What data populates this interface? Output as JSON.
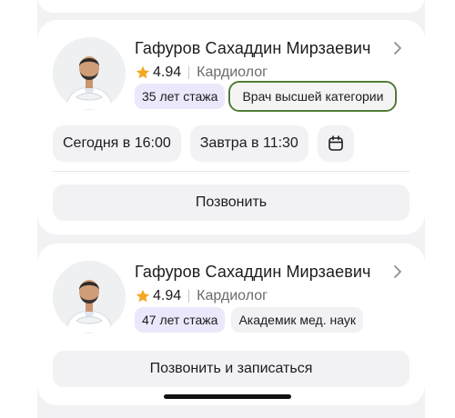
{
  "doctors": [
    {
      "name": "Гафуров Сахаддин Мирзаевич",
      "rating": "4.94",
      "specialty": "Кардиолог",
      "experience": "35 лет стажа",
      "category": "Врач высшей категории",
      "slots": [
        "Сегодня в 16:00",
        "Завтра в 11:30"
      ],
      "calendar_icon": "calendar-icon",
      "action": "Позвонить"
    },
    {
      "name": "Гафуров Сахаддин Мирзаевич",
      "rating": "4.94",
      "specialty": "Кардиолог",
      "experience": "47 лет стажа",
      "category": "Академик мед. наук",
      "action": "Позвонить и записаться"
    }
  ],
  "colors": {
    "star": "#f5a623",
    "experience_tag": "#ece8fb",
    "highlight_outline": "#4f7a35",
    "button_bg": "#f2f2f5"
  }
}
